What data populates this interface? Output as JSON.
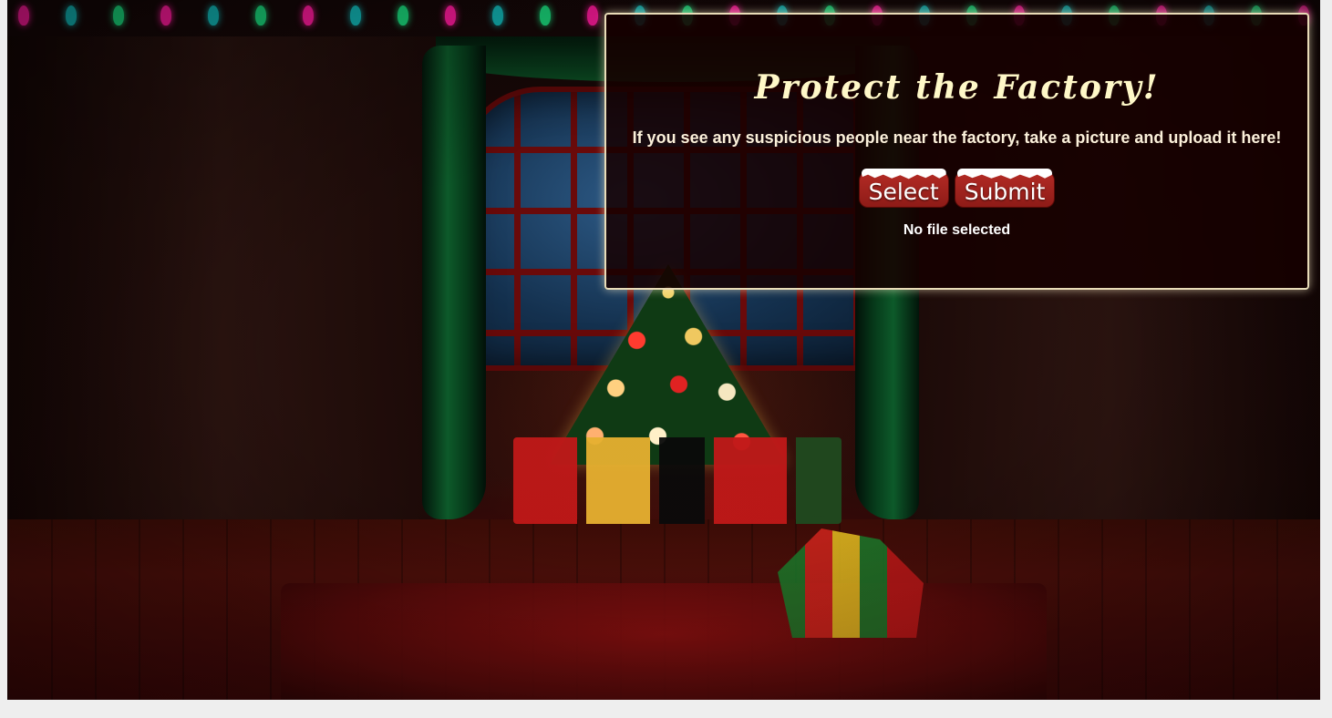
{
  "panel": {
    "title": "Protect the Factory!",
    "description": "If you see any suspicious people near the factory, take a picture and upload it here!",
    "select_label": "Select",
    "submit_label": "Submit",
    "file_status": "No file selected"
  },
  "colors": {
    "panel_background": "#160000",
    "panel_border": "#e9dcb8",
    "title_color": "#fff8c8",
    "button_red": "#a3241f",
    "page_background": "#eeeeee"
  },
  "background": {
    "scene": "christmas-tree-room",
    "bulb_colors": [
      "#ff1a9c",
      "#12b5b5",
      "#1ad67a"
    ]
  }
}
